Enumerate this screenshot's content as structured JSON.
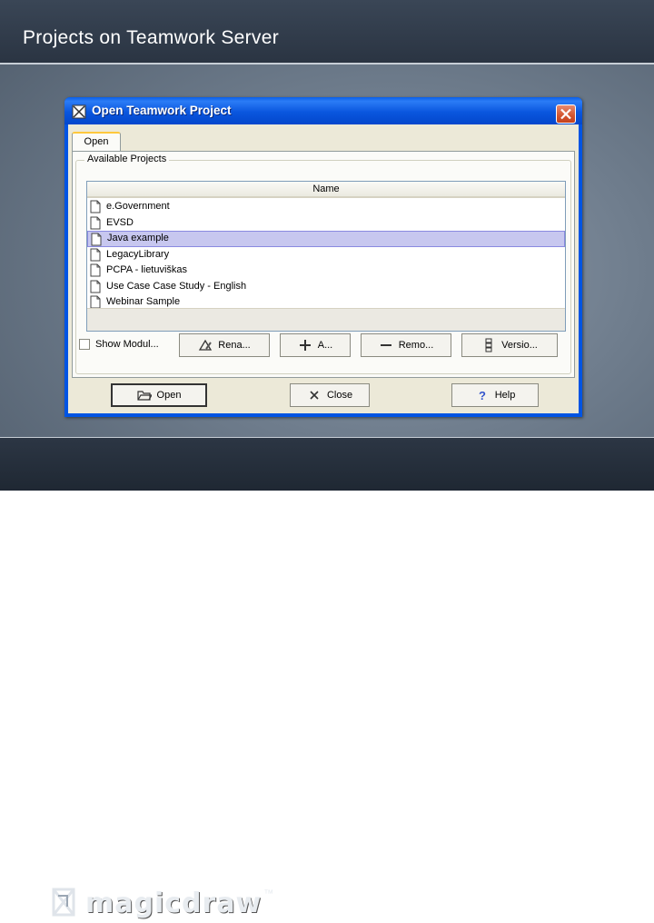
{
  "slide": {
    "title": "Projects on Teamwork Server",
    "logo_text": "magicdraw",
    "logo_tm": "™"
  },
  "dialog": {
    "title": "Open Teamwork Project",
    "tab_label": "Open",
    "group_label": "Available Projects",
    "table_header": "Name",
    "projects": [
      {
        "name": "e.Government",
        "selected": false
      },
      {
        "name": "EVSD",
        "selected": false
      },
      {
        "name": "Java example",
        "selected": true
      },
      {
        "name": "LegacyLibrary",
        "selected": false
      },
      {
        "name": "PCPA - lietuviškas",
        "selected": false
      },
      {
        "name": "Use Case Case Study - English",
        "selected": false
      },
      {
        "name": "Webinar Sample",
        "selected": false
      }
    ],
    "show_modules_label": "Show Modul...",
    "rename_label": "Rena...",
    "add_label": "A...",
    "remove_label": "Remo...",
    "versions_label": "Versio...",
    "open_label": "Open",
    "close_label": "Close",
    "help_label": "Help"
  },
  "colors": {
    "titlebar": "#0054e3",
    "selection": "#c7c7ef",
    "dialog_face": "#ece9d8"
  }
}
